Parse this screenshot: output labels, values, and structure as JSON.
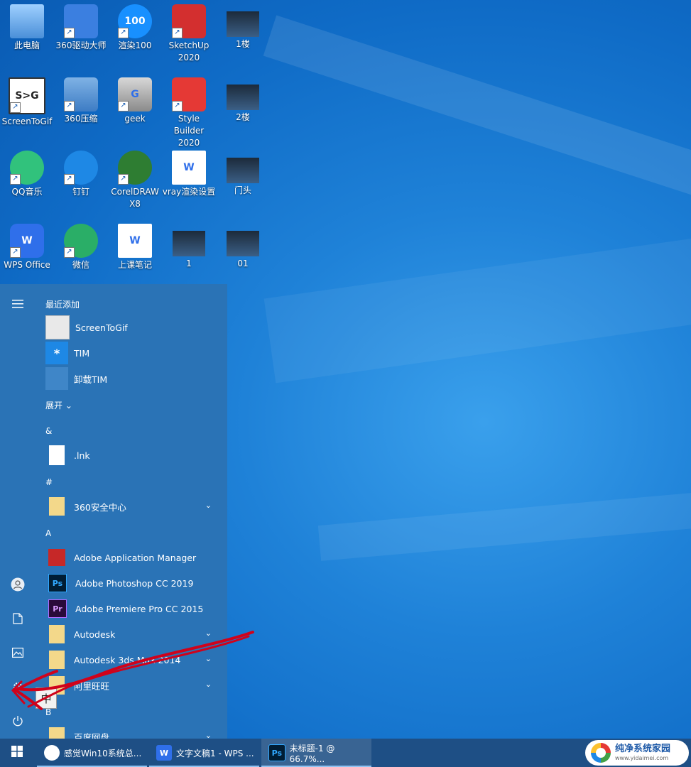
{
  "desktop": {
    "icons": [
      {
        "label": "此电脑",
        "icon": "computer-icon",
        "shortcut": false
      },
      {
        "label": "360驱动大师",
        "icon": "driver-master-icon",
        "shortcut": true
      },
      {
        "label": "渲染100",
        "icon": "render100-icon",
        "shortcut": true,
        "glyph": "100"
      },
      {
        "label": "SketchUp 2020",
        "icon": "sketchup-icon",
        "shortcut": true
      },
      {
        "label": "1楼",
        "icon": "image-thumbnail-icon",
        "shortcut": false
      },
      {
        "label": "ScreenToGif",
        "icon": "screentogif-icon",
        "shortcut": true,
        "glyph": "S>G"
      },
      {
        "label": "360压缩",
        "icon": "archive-icon",
        "shortcut": true
      },
      {
        "label": "geek",
        "icon": "geek-uninstaller-icon",
        "shortcut": true,
        "glyph": "G"
      },
      {
        "label": "Style Builder 2020",
        "icon": "style-builder-icon",
        "shortcut": true
      },
      {
        "label": "2楼",
        "icon": "image-thumbnail-icon",
        "shortcut": false
      },
      {
        "label": "QQ音乐",
        "icon": "qq-music-icon",
        "shortcut": true
      },
      {
        "label": "钉钉",
        "icon": "dingtalk-icon",
        "shortcut": true
      },
      {
        "label": "CorelDRAW X8",
        "icon": "coreldraw-icon",
        "shortcut": true
      },
      {
        "label": "vray渲染设置",
        "icon": "wps-doc-icon",
        "shortcut": false,
        "glyph": "W"
      },
      {
        "label": "门头",
        "icon": "image-thumbnail-icon",
        "shortcut": false
      },
      {
        "label": "WPS Office",
        "icon": "wps-office-icon",
        "shortcut": true,
        "glyph": "W"
      },
      {
        "label": "微信",
        "icon": "wechat-icon",
        "shortcut": true
      },
      {
        "label": "上课笔记",
        "icon": "wps-doc-icon",
        "shortcut": false,
        "glyph": "W"
      },
      {
        "label": "1",
        "icon": "image-thumbnail-icon",
        "shortcut": false
      },
      {
        "label": "01",
        "icon": "image-thumbnail-icon",
        "shortcut": false
      }
    ]
  },
  "start_menu": {
    "sections": {
      "recent": "最近添加",
      "expand": "展开",
      "amp": "&",
      "hash": "#",
      "a": "A",
      "b": "B"
    },
    "recent_apps": [
      {
        "label": "ScreenToGif",
        "icon": "screentogif-icon"
      },
      {
        "label": "TIM",
        "icon": "tim-icon",
        "glyph": "*"
      },
      {
        "label": "卸载TIM",
        "icon": "recycle-bin-icon"
      }
    ],
    "apps": [
      {
        "label": ".lnk",
        "icon": "file-icon",
        "folder": false
      },
      {
        "label": "360安全中心",
        "icon": "folder-icon",
        "folder": true
      },
      {
        "label": "Adobe Application Manager",
        "icon": "adobe-icon",
        "folder": false
      },
      {
        "label": "Adobe Photoshop CC 2019",
        "icon": "photoshop-icon",
        "folder": false,
        "glyph": "Ps"
      },
      {
        "label": "Adobe Premiere Pro CC 2015",
        "icon": "premiere-icon",
        "folder": false,
        "glyph": "Pr"
      },
      {
        "label": "Autodesk",
        "icon": "folder-icon",
        "folder": true
      },
      {
        "label": "Autodesk 3ds Max 2014",
        "icon": "folder-icon",
        "folder": true
      },
      {
        "label": "阿里旺旺",
        "icon": "folder-icon",
        "folder": true
      },
      {
        "label": "百度网盘",
        "icon": "folder-icon",
        "folder": true
      }
    ],
    "ime_indicator": "中"
  },
  "taskbar": {
    "tasks": [
      {
        "label": "感觉Win10系统总...",
        "icon": "edge-icon"
      },
      {
        "label": "文字文稿1 - WPS ...",
        "icon": "wps-writer-icon",
        "glyph": "W"
      },
      {
        "label": "未标题-1 @ 66.7%...",
        "icon": "photoshop-icon",
        "glyph": "Ps"
      }
    ]
  },
  "watermark": {
    "title": "纯净系统家园",
    "url": "www.yidaimei.com"
  },
  "colors": {
    "start_menu_bg": "#2a73b6",
    "taskbar_bg": "#1e4f85",
    "annotation": "#d0021b"
  }
}
